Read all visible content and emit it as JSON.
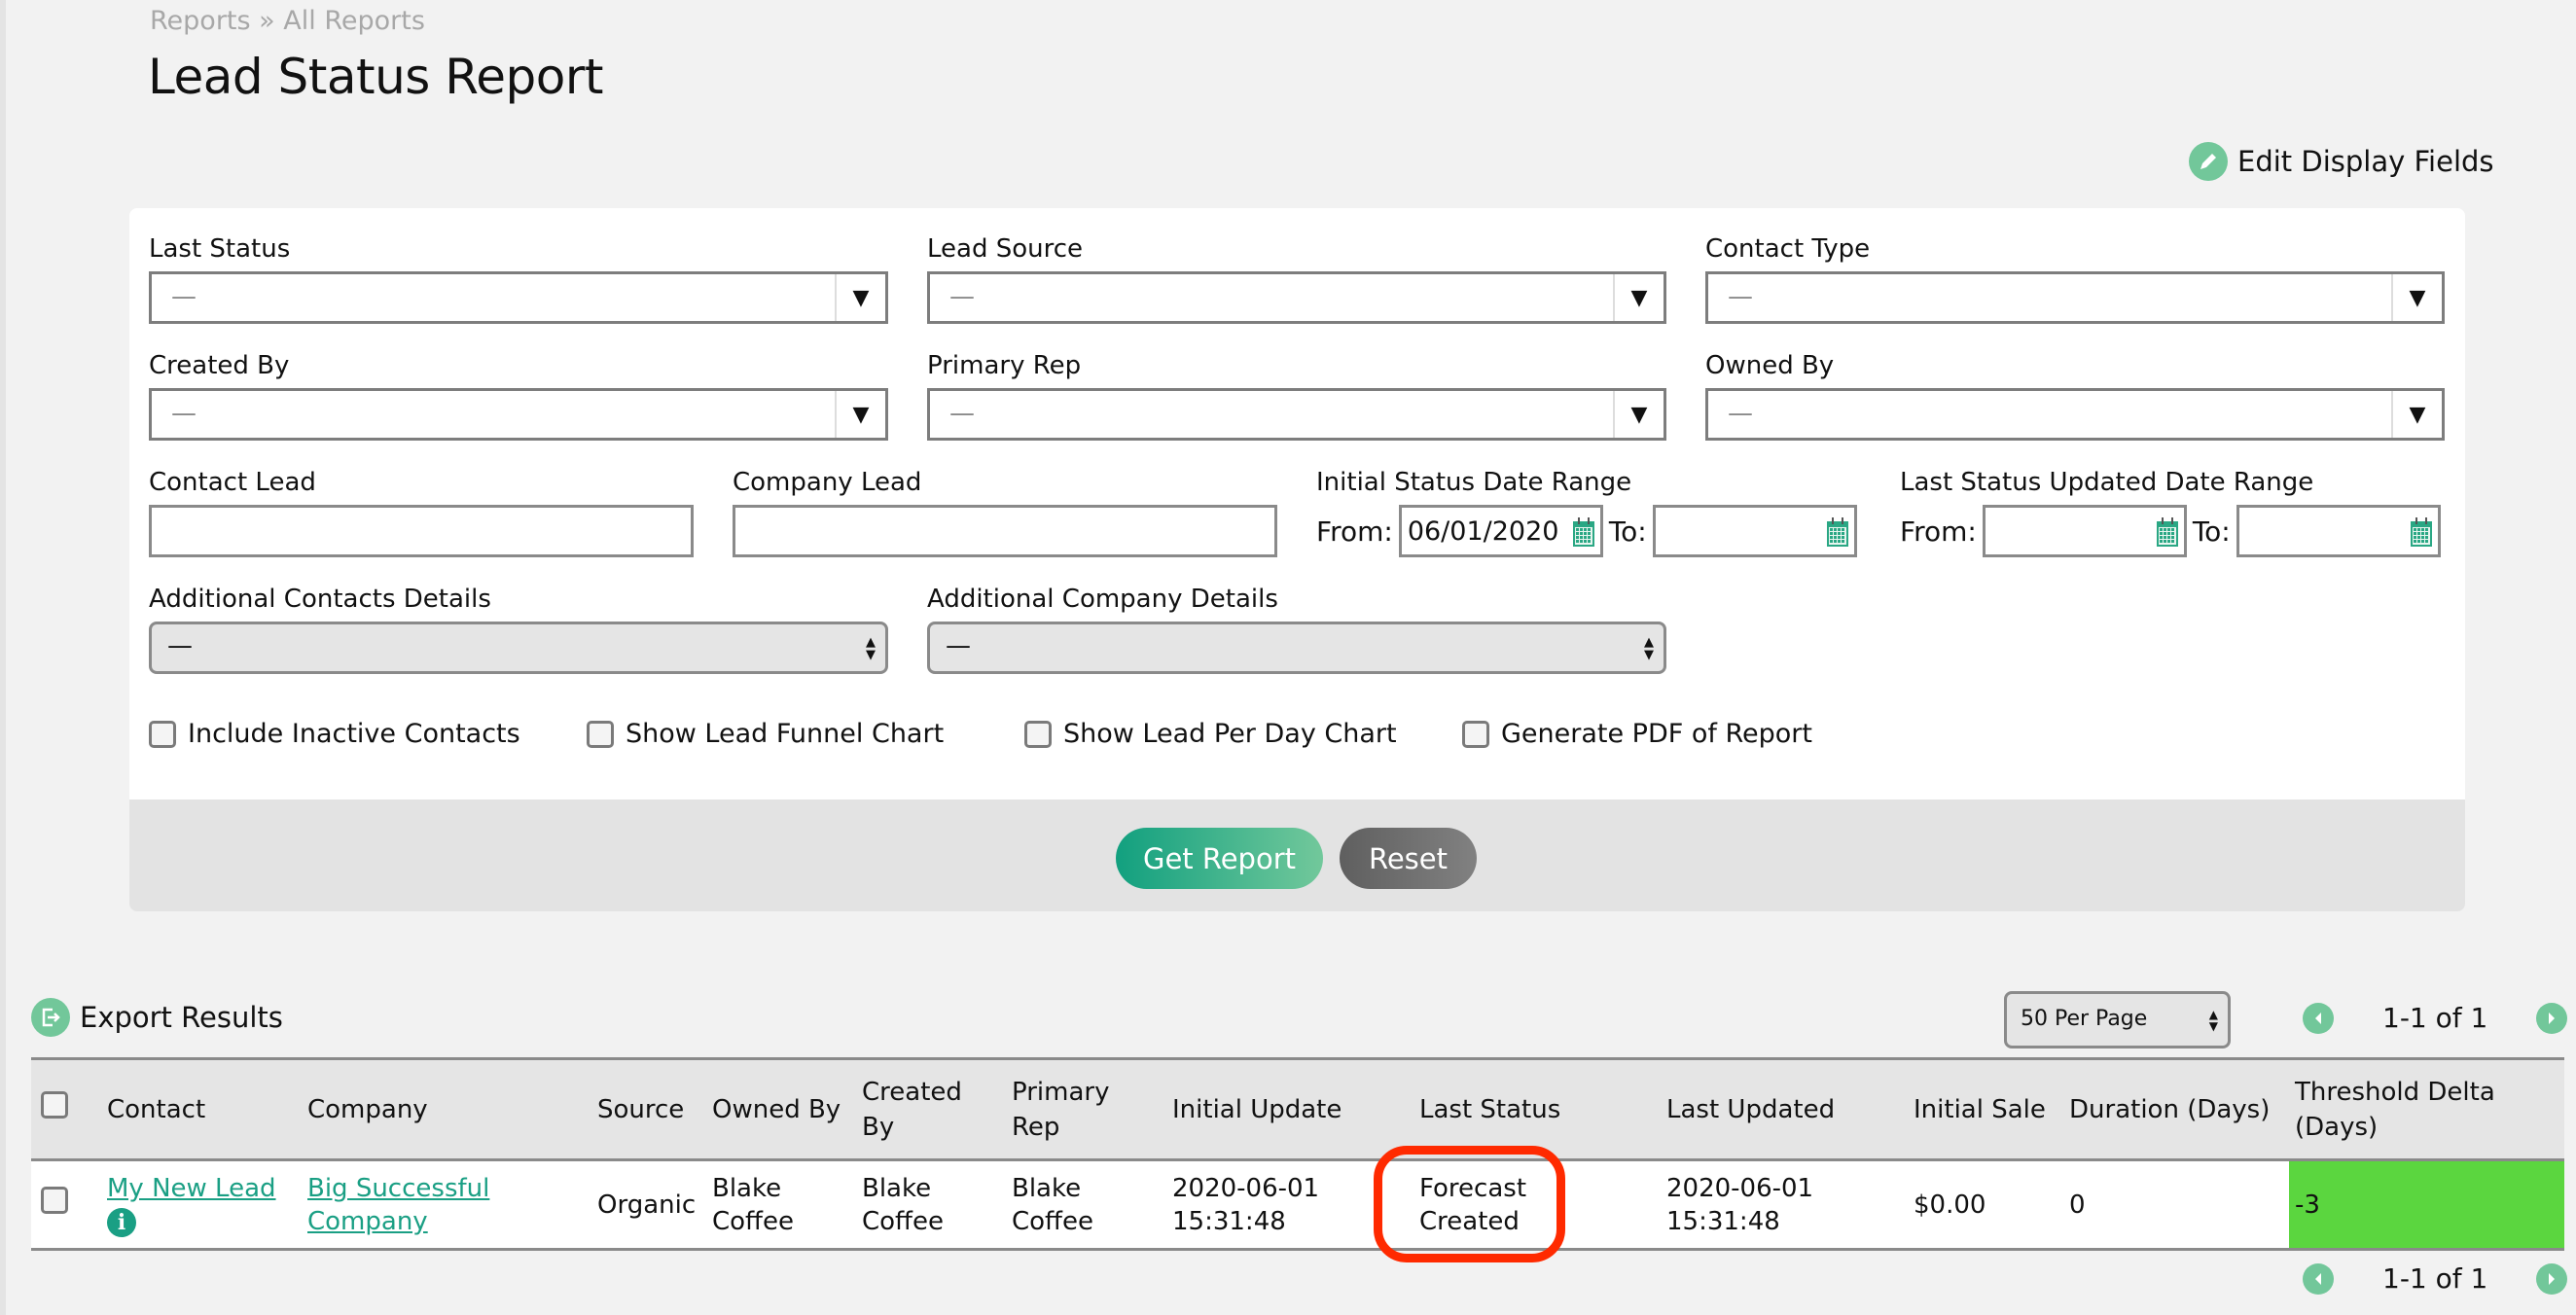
{
  "breadcrumb": {
    "parent": "Reports",
    "separator": "»",
    "current": "All Reports"
  },
  "page_title": "Lead Status Report",
  "edit_display_fields": {
    "label": "Edit Display Fields",
    "icon": "pencil-icon"
  },
  "filters": {
    "last_status": {
      "label": "Last Status",
      "value": "—"
    },
    "lead_source": {
      "label": "Lead Source",
      "value": "—"
    },
    "contact_type": {
      "label": "Contact Type",
      "value": "—"
    },
    "created_by": {
      "label": "Created By",
      "value": "—"
    },
    "primary_rep": {
      "label": "Primary Rep",
      "value": "—"
    },
    "owned_by": {
      "label": "Owned By",
      "value": "—"
    },
    "contact_lead": {
      "label": "Contact Lead",
      "value": ""
    },
    "company_lead": {
      "label": "Company Lead",
      "value": ""
    },
    "initial_status_range": {
      "label": "Initial Status Date Range",
      "from_label": "From:",
      "from_value": "06/01/2020",
      "to_label": "To:",
      "to_value": ""
    },
    "last_status_updated_range": {
      "label": "Last Status Updated Date Range",
      "from_label": "From:",
      "from_value": "",
      "to_label": "To:",
      "to_value": ""
    },
    "additional_contacts": {
      "label": "Additional Contacts Details",
      "value": "—"
    },
    "additional_company": {
      "label": "Additional Company Details",
      "value": "—"
    },
    "checkboxes": [
      {
        "label": "Include Inactive Contacts",
        "checked": false
      },
      {
        "label": "Show Lead Funnel Chart",
        "checked": false
      },
      {
        "label": "Show Lead Per Day Chart",
        "checked": false
      },
      {
        "label": "Generate PDF of Report",
        "checked": false
      }
    ],
    "get_report_label": "Get Report",
    "reset_label": "Reset"
  },
  "results": {
    "export_label": "Export Results",
    "per_page": "50 Per Page",
    "pagination_text": "1-1 of 1",
    "columns": [
      "Contact",
      "Company",
      "Source",
      "Owned By",
      "Created By",
      "Primary Rep",
      "Initial Update",
      "Last Status",
      "Last Updated",
      "Initial Sale",
      "Duration (Days)",
      "Threshold Delta (Days)"
    ],
    "rows": [
      {
        "contact": "My New Lead",
        "company": "Big Successful Company",
        "source": "Organic",
        "owned_by": "Blake Coffee",
        "created_by": "Blake Coffee",
        "primary_rep": "Blake Coffee",
        "initial_update": "2020-06-01 15:31:48",
        "last_status": "Forecast Created",
        "last_updated": "2020-06-01 15:31:48",
        "initial_sale": "$0.00",
        "duration_days": "0",
        "threshold_delta_days": "-3"
      }
    ]
  },
  "colors": {
    "accent_green": "#72c79a",
    "link_green": "#1a9f84",
    "delta_green": "#5bd63f",
    "highlight_red": "#ff2a00"
  }
}
